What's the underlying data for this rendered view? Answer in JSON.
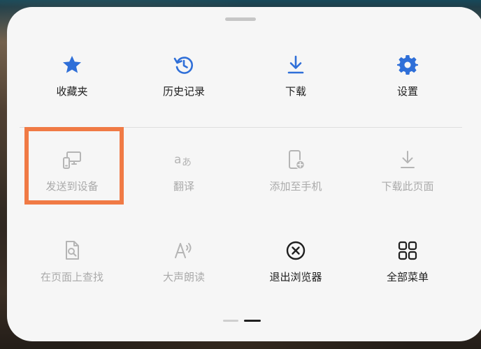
{
  "colors": {
    "accent_blue": "#2f6fd8",
    "disabled_gray": "#b5b5b5",
    "text_dark": "#1f1f1f",
    "text_disabled": "#aaaaaa",
    "highlight_orange": "#f07a45"
  },
  "menu": {
    "row1": [
      {
        "label": "收藏夹",
        "icon": "star-icon"
      },
      {
        "label": "历史记录",
        "icon": "history-icon"
      },
      {
        "label": "下载",
        "icon": "download-icon"
      },
      {
        "label": "设置",
        "icon": "gear-icon"
      }
    ],
    "row2": [
      {
        "label": "发送到设备",
        "icon": "send-to-device-icon",
        "highlighted": true
      },
      {
        "label": "翻译",
        "icon": "translate-icon"
      },
      {
        "label": "添加至手机",
        "icon": "add-to-phone-icon"
      },
      {
        "label": "下载此页面",
        "icon": "download-page-icon"
      }
    ],
    "row3": [
      {
        "label": "在页面上查找",
        "icon": "find-in-page-icon"
      },
      {
        "label": "大声朗读",
        "icon": "read-aloud-icon"
      },
      {
        "label": "退出浏览器",
        "icon": "close-circle-icon"
      },
      {
        "label": "全部菜单",
        "icon": "grid-icon"
      }
    ]
  },
  "pager": {
    "pages": 2,
    "current": 2
  }
}
